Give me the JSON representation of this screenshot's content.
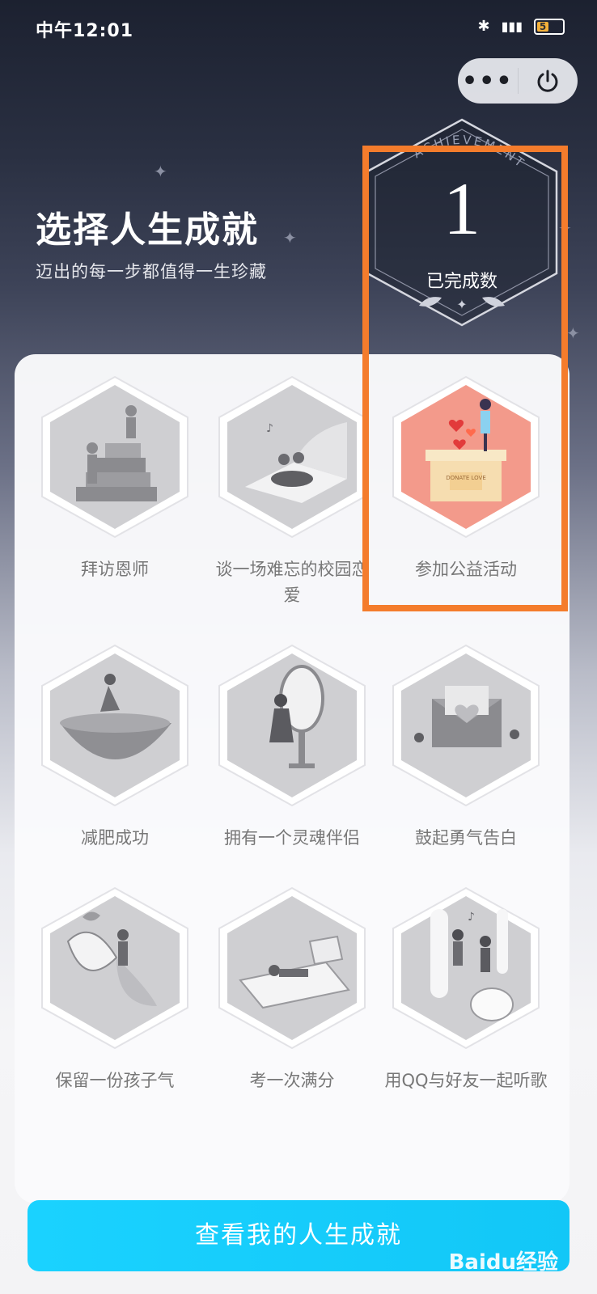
{
  "status_bar": {
    "time": "中午12:01",
    "battery": "5"
  },
  "capsule": {
    "more_icon": "more-dots-icon",
    "close_icon": "power-icon"
  },
  "header": {
    "title": "选择人生成就",
    "subtitle": "迈出的每一步都值得一生珍藏"
  },
  "badge": {
    "arc_text": "ACHIEVEMENT",
    "count": "1",
    "label": "已完成数"
  },
  "achievements": [
    {
      "label": "拜访恩师",
      "completed": false
    },
    {
      "label": "谈一场难忘的校园恋爱",
      "completed": false
    },
    {
      "label": "参加公益活动",
      "completed": true,
      "box_text": "DONATE LOVE"
    },
    {
      "label": "减肥成功",
      "completed": false
    },
    {
      "label": "拥有一个灵魂伴侣",
      "completed": false
    },
    {
      "label": "鼓起勇气告白",
      "completed": false
    },
    {
      "label": "保留一份孩子气",
      "completed": false
    },
    {
      "label": "考一次满分",
      "completed": false
    },
    {
      "label": "用QQ与好友一起听歌",
      "completed": false
    }
  ],
  "cta": {
    "label": "查看我的人生成就"
  },
  "watermark": {
    "text": "Baidu经验"
  },
  "colors": {
    "accent": "#12c7f7",
    "highlight": "#f47c2c",
    "completed_hex": "#f39a8b"
  }
}
